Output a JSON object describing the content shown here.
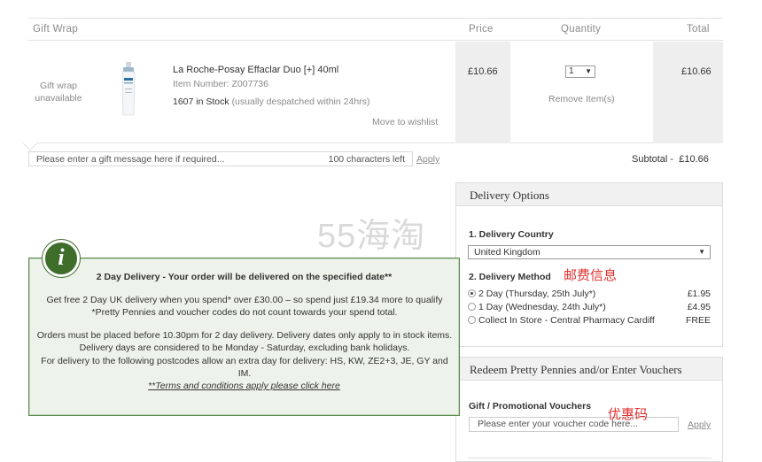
{
  "table": {
    "headers": {
      "gift_wrap": "Gift Wrap",
      "price": "Price",
      "quantity": "Quantity",
      "total": "Total"
    }
  },
  "item": {
    "gift_wrap_status": "Gift wrap unavailable",
    "name": "La Roche-Posay Effaclar Duo [+] 40ml",
    "item_number": "Item Number: Z007736",
    "stock": "1607 in Stock",
    "stock_note": "(usually despatched within 24hrs)",
    "move_to_wishlist": "Move to wishlist",
    "price": "£10.66",
    "quantity": "1",
    "remove": "Remove Item(s)",
    "total": "£10.66",
    "image": "product-tube"
  },
  "gift_message": {
    "placeholder": "Please enter a gift message here if required...",
    "chars_left": "100 characters left",
    "apply": "Apply"
  },
  "subtotal": {
    "label": "Subtotal -",
    "value": "£10.66"
  },
  "delivery": {
    "title": "Delivery Options",
    "country_label": "1. Delivery Country",
    "country_value": "United Kingdom",
    "method_label": "2. Delivery Method",
    "options": [
      {
        "label": "2 Day (Thursday, 25th July*)",
        "price": "£1.95",
        "selected": true
      },
      {
        "label": "1 Day (Wednesday, 24th July*)",
        "price": "£4.95",
        "selected": false
      },
      {
        "label": "Collect In Store - Central Pharmacy Cardiff",
        "price": "FREE",
        "selected": false
      }
    ]
  },
  "voucher": {
    "title": "Redeem Pretty Pennies and/or Enter Vouchers",
    "label": "Gift / Promotional Vouchers",
    "placeholder": "Please enter your voucher code here...",
    "apply": "Apply"
  },
  "popup": {
    "icon": "i",
    "title": "2 Day Delivery - Your order will be delivered on the specified date**",
    "para1": "Get free 2 Day UK delivery when you spend* over £30.00 – so spend just £19.34 more to qualify *Pretty Pennies and voucher codes do not count towards your spend total.",
    "para2": "Orders must be placed before 10.30pm for 2 day delivery. Delivery dates only apply to in stock items. Delivery days are considered to be Monday - Saturday, excluding bank holidays.",
    "para3": "For delivery to the following postcodes allow an extra day for delivery: HS, KW, ZE2+3, JE, GY and IM.",
    "terms_link": "**Terms and conditions apply please click here"
  },
  "overlay": {
    "watermark": "55海淘",
    "annotation_shipping": "邮费信息",
    "annotation_coupon": "优惠码"
  },
  "colors": {
    "popup_bg": "#edf3ea",
    "popup_border": "#5a8a4a",
    "badge": "#3f6e2a",
    "annotation": "#e03030"
  }
}
